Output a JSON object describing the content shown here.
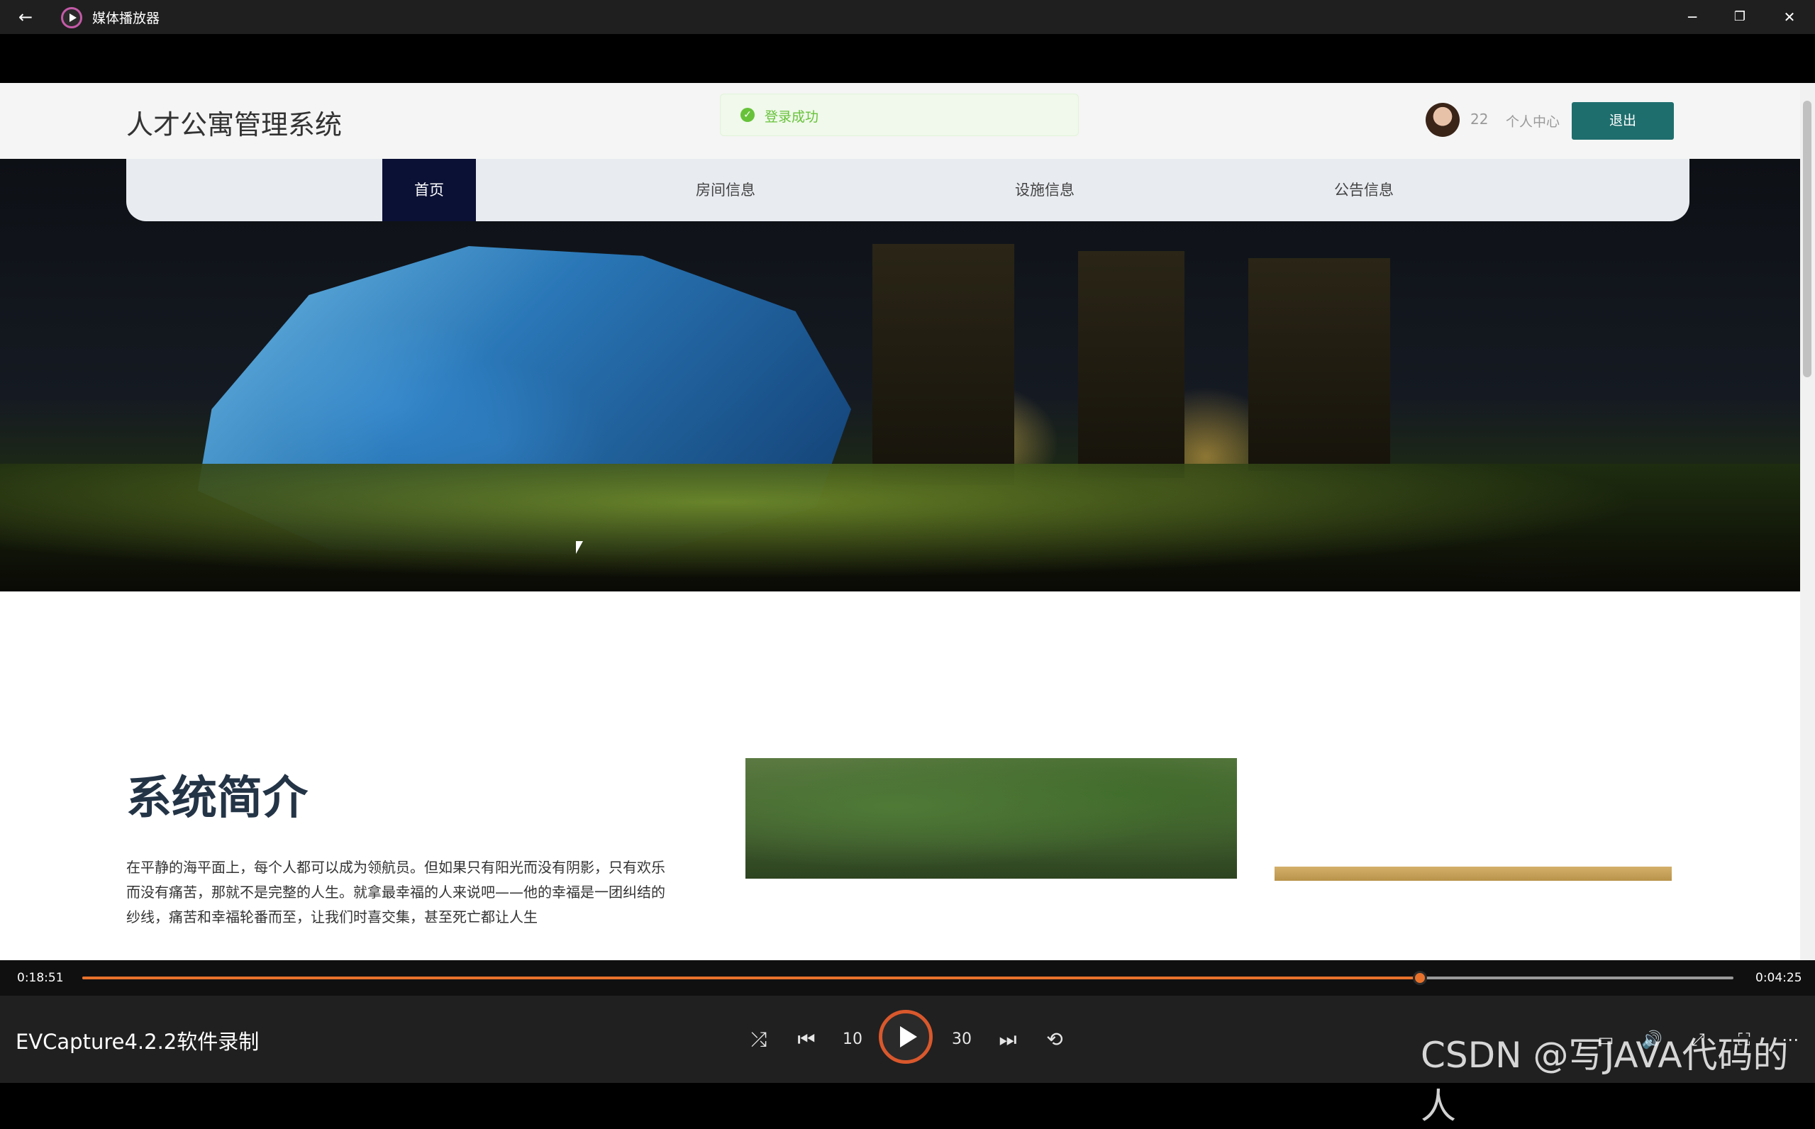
{
  "window": {
    "title": "媒体播放器",
    "back_icon": "arrow-left-icon",
    "minimize": "─",
    "restore": "❐",
    "close": "✕"
  },
  "site": {
    "title": "人才公寓管理系统",
    "toast": "登录成功",
    "username": "22",
    "profile_link": "个人中心",
    "logout_button": "退出",
    "nav": [
      {
        "label": "首页",
        "active": true
      },
      {
        "label": "房间信息",
        "active": false
      },
      {
        "label": "设施信息",
        "active": false
      },
      {
        "label": "公告信息",
        "active": false
      }
    ],
    "intro": {
      "title": "系统简介",
      "text": "在平静的海平面上，每个人都可以成为领航员。但如果只有阳光而没有阴影，只有欢乐而没有痛苦，那就不是完整的人生。就拿最幸福的人来说吧——他的幸福是一团纠结的纱线，痛苦和幸福轮番而至，让我们时喜交集，甚至死亡都让人生"
    }
  },
  "player": {
    "elapsed": "0:18:51",
    "remaining": "0:04:25",
    "progress_fraction": 0.81,
    "recording_label": "EVCapture4.2.2软件录制",
    "controls": [
      "shuffle",
      "previous",
      "rewind-10",
      "play",
      "forward-30",
      "next",
      "repeat"
    ],
    "rewind_label": "10",
    "forward_label": "30",
    "accent_color": "#e8722c"
  },
  "watermark": "CSDN @写JAVA代码的人"
}
